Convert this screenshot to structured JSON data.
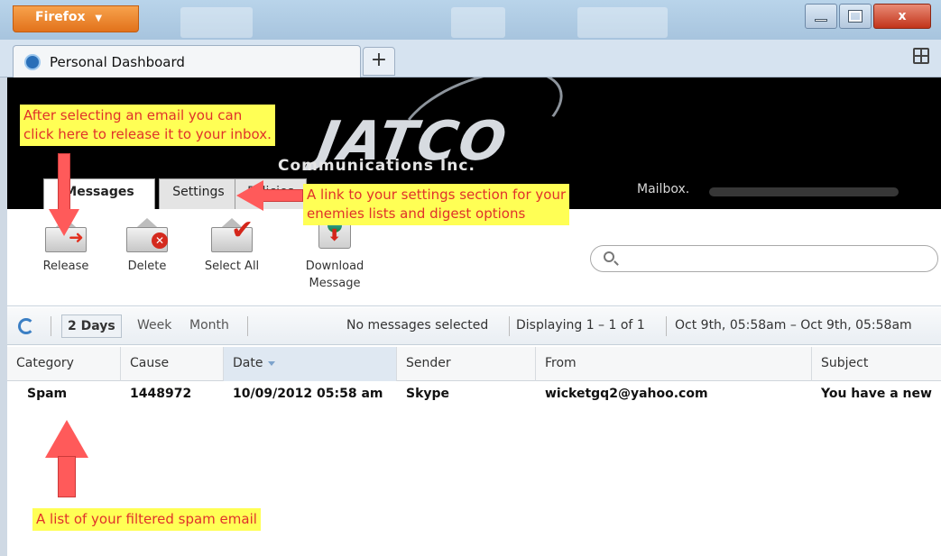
{
  "browser": {
    "button_label": "Firefox",
    "tab_title": "Personal Dashboard",
    "new_tab_label": "+",
    "close_label": "x"
  },
  "app": {
    "logo_text": "JATCO",
    "logo_subtitle": "Communications Inc.",
    "tabs": [
      {
        "label": "Messages"
      },
      {
        "label": "Settings"
      },
      {
        "label": "Policies"
      }
    ],
    "mailbox_label": "Mailbox."
  },
  "toolbar": {
    "release_label": "Release",
    "delete_label": "Delete",
    "select_all_label": "Select All",
    "download_label_line1": "Download",
    "download_label_line2": "Message",
    "search_placeholder": ""
  },
  "filter": {
    "ranges": [
      "2 Days",
      "Week",
      "Month"
    ],
    "selection_status": "No messages selected",
    "displaying": "Displaying 1 – 1 of 1",
    "date_range": "Oct 9th, 05:58am – Oct 9th, 05:58am"
  },
  "grid": {
    "columns": [
      "Category",
      "Cause",
      "Date",
      "Sender",
      "From",
      "Subject"
    ],
    "rows": [
      {
        "category": "Spam",
        "cause": "1448972",
        "date": "10/09/2012 05:58 am",
        "sender": "Skype",
        "from": "wicketgq2@yahoo.com",
        "subject": "You have a new"
      }
    ]
  },
  "annotations": {
    "release_note_line1": "After selecting an email you can",
    "release_note_line2": "click here to release it to your inbox.",
    "settings_note_line1": "A link to your settings section for your",
    "settings_note_line2": "enemies lists and digest options",
    "list_note": "A list of your filtered spam email"
  },
  "colors": {
    "annotation_bg": "#ffff55",
    "annotation_text": "#e0312a",
    "arrow": "#ff5a5a",
    "header_bg": "#000000"
  }
}
